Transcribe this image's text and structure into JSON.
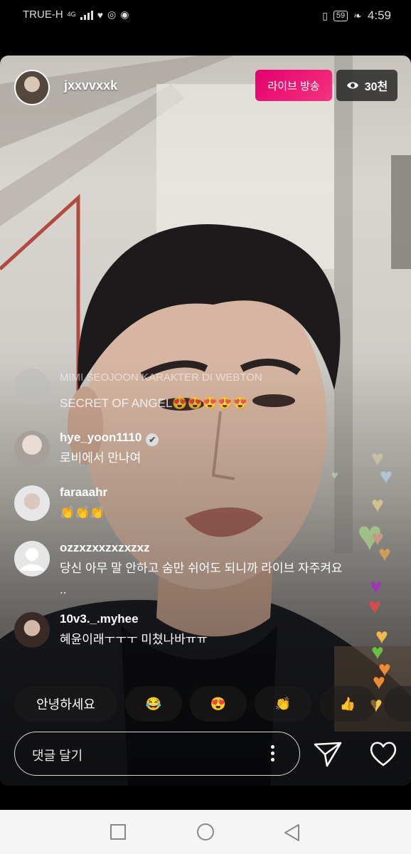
{
  "status_bar": {
    "carrier": "TRUE-H",
    "network": "4G",
    "battery": "59",
    "time": "4:59"
  },
  "live": {
    "host_username": "jxxvvxxk",
    "live_label": "라이브 방송",
    "viewer_count": "30천"
  },
  "comments": [
    {
      "username": "",
      "text": "SECRET OF ANGEL😍😍😍😍😍",
      "faded_text": "MIMI SEOJOON KARAKTER DI WEBTON"
    },
    {
      "username": "hye_yoon1110",
      "text": "로비에서 만나여",
      "verified": true
    },
    {
      "username": "faraaahr",
      "text": "👏👏👏"
    },
    {
      "username": "ozzxzxxzxzxzxz",
      "text": "당신 아무 말 안하고 숨만 쉬어도 되니까 라이브 자주켜요 .."
    },
    {
      "username": "10v3._.myhee",
      "text": "혜윤이래ㅜㅜㅜ 미쳤나바ㅠㅠ"
    }
  ],
  "quick_replies": [
    "안녕하세요",
    "😂",
    "😍",
    "👏",
    "👍"
  ],
  "comment_input": {
    "placeholder": "댓글 달기"
  },
  "icons": {
    "send": "send-icon",
    "heart": "heart-icon",
    "more": "more-vertical-icon",
    "eye": "eye-icon"
  },
  "colors": {
    "live_badge": "#e4006f",
    "viewer_badge": "#282828"
  }
}
